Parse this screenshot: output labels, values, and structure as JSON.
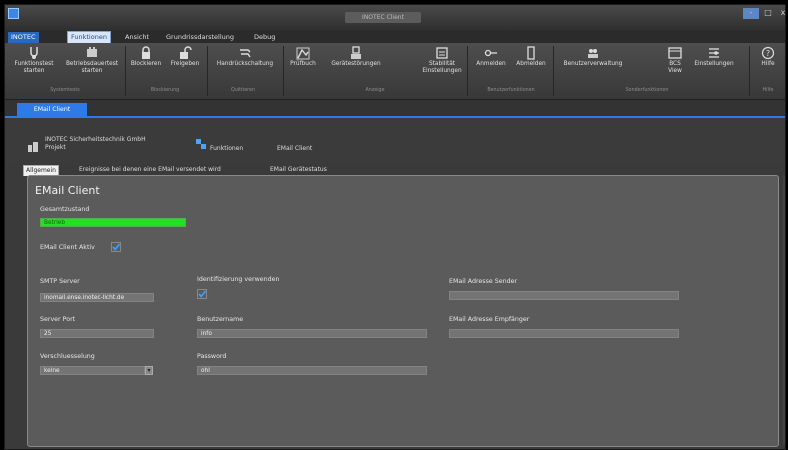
{
  "window": {
    "title": "INOTEC Client",
    "controls": [
      "-",
      "□",
      "x"
    ]
  },
  "menu": {
    "tabs": [
      "INOTEC",
      "Funktionen",
      "Ansicht",
      "Grundrissdarstellung",
      "Debug"
    ],
    "active": "Funktionen"
  },
  "ribbon": {
    "buttons": [
      {
        "icon": "funktionstest-icon",
        "line1": "Funktionstest",
        "line2": "starten"
      },
      {
        "icon": "betriebsdauertest-icon",
        "line1": "Betriebsdauertest",
        "line2": "starten"
      },
      {
        "icon": "lock-icon",
        "line1": "Blockieren",
        "line2": ""
      },
      {
        "icon": "unlock-icon",
        "line1": "Freigeben",
        "line2": ""
      },
      {
        "icon": "handrueckschaltung-icon",
        "line1": "Handrückschaltung",
        "line2": ""
      },
      {
        "icon": "pruefbuch-icon",
        "line1": "Prüfbuch",
        "line2": ""
      },
      {
        "icon": "geraetestoerungen-icon",
        "line1": "Gerätestörungen",
        "line2": ""
      },
      {
        "icon": "stabilitat-icon",
        "line1": "Stabilität",
        "line2": "Einstellungen"
      },
      {
        "icon": "anmelden-icon",
        "line1": "Anmelden",
        "line2": ""
      },
      {
        "icon": "abmelden-icon",
        "line1": "Abmelden",
        "line2": ""
      },
      {
        "icon": "benutzerverwaltung-icon",
        "line1": "Benutzerverwaltung",
        "line2": ""
      },
      {
        "icon": "bcs-view-icon",
        "line1": "BCS",
        "line2": "View"
      },
      {
        "icon": "einstellungen-icon",
        "line1": "Einstellungen",
        "line2": ""
      },
      {
        "icon": "help-icon",
        "line1": "Hilfe",
        "line2": ""
      }
    ],
    "groups": [
      "Systemtests",
      "Blockierung",
      "Quittieren",
      "Anzeige",
      "Benutzerfunktionen",
      "Sonderfunktionen",
      "Hilfe"
    ]
  },
  "doc_tab": "EMail Client",
  "breadcrumb": {
    "company": "INOTEC Sicherheitstechnik GmbH",
    "project": "Projekt",
    "item1": "Funktionen",
    "item2": "EMail Client"
  },
  "content_tabs": [
    "Allgemein",
    "Ereignisse bei denen eine EMail versendet wird",
    "EMail Gerätestatus"
  ],
  "panel": {
    "title": "EMail Client",
    "gesamtzustand_label": "Gesamtzustand",
    "status_value": "Betrieb",
    "client_aktiv_label": "EMail Client Aktiv",
    "client_aktiv_checked": true,
    "smtp_label": "SMTP Server",
    "smtp_value": "inomail.ense.inotec-licht.de",
    "port_label": "Server Port",
    "port_value": "25",
    "verschl_label": "Verschluesselung",
    "verschl_value": "keine",
    "ident_label": "Identifizierung verwenden",
    "ident_checked": true,
    "user_label": "Benutzername",
    "user_value": "info",
    "pass_label": "Password",
    "pass_value": "ohl",
    "sender_label": "EMail Adresse Sender",
    "sender_value": "",
    "receiver_label": "EMail Adresse Empfänger",
    "receiver_value": ""
  },
  "colors": {
    "accent": "#2d7ae8",
    "status_ok": "#22e022",
    "panel": "#5b5b5b"
  }
}
